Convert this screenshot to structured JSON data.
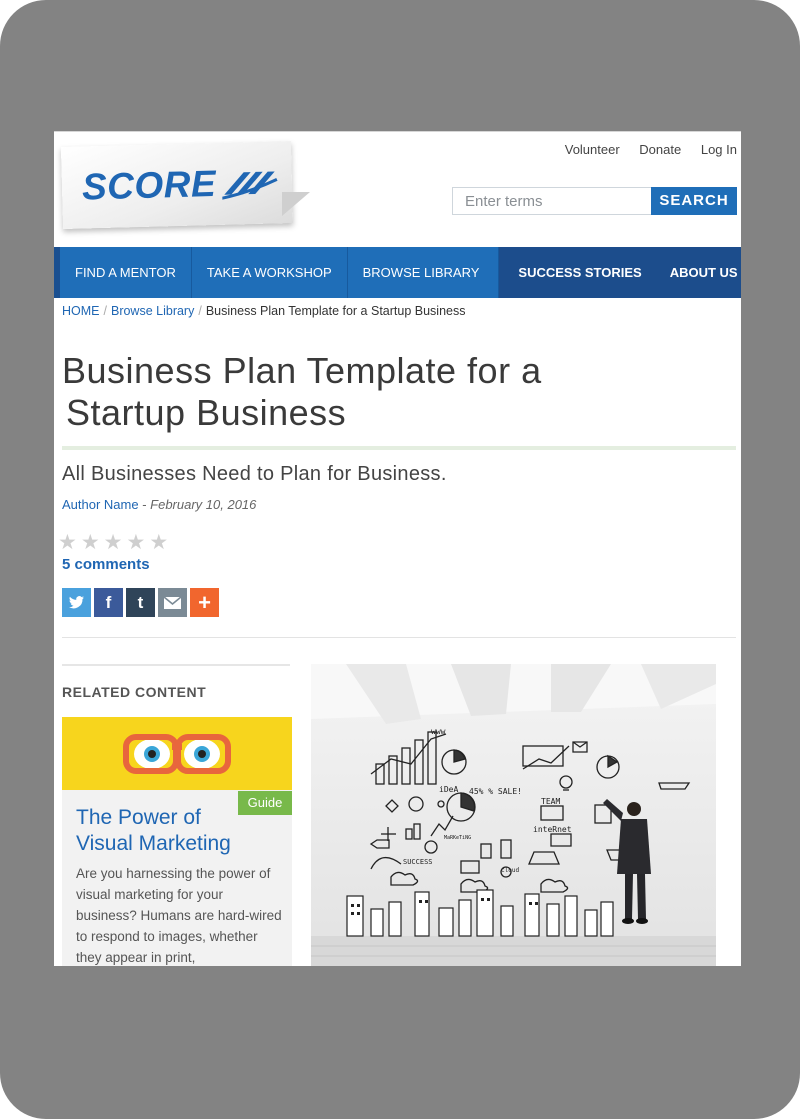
{
  "brand": {
    "logo_text": "SCORE",
    "primary_color": "#1f6eb8",
    "dark_nav_color": "#1c4d8c"
  },
  "top_links": [
    "Volunteer",
    "Donate",
    "Log In"
  ],
  "search": {
    "placeholder": "Enter terms",
    "button_label": "SEARCH"
  },
  "nav": [
    "FIND A MENTOR",
    "TAKE A WORKSHOP",
    "BROWSE LIBRARY",
    "SUCCESS STORIES",
    "ABOUT US"
  ],
  "breadcrumb": {
    "home": "HOME",
    "library": "Browse Library",
    "current": "Business Plan Template for a Startup Business"
  },
  "article": {
    "title_line1": "Business Plan Template for a",
    "title_line2": "Startup Business",
    "subtitle": "All Businesses Need to Plan for Business.",
    "author": "Author Name",
    "date_sep": " - ",
    "date": "February 10, 2016",
    "rating": 0,
    "comments": "5 comments"
  },
  "share_icons": [
    "twitter-icon",
    "facebook-icon",
    "tumblr-icon",
    "email-icon",
    "plus-icon"
  ],
  "related": {
    "heading": "RELATED CONTENT",
    "badge": "Guide",
    "card_title_line1": "The Power of",
    "card_title_line2": "Visual Marketing",
    "card_text": "Are you harnessing the power of visual marketing for your business? Humans are hard-wired to respond to images, whether they appear in print,"
  },
  "hero_texts": {
    "www": "www",
    "idea": "iDeA",
    "sale": "45% % SALE!",
    "team": "TEAM",
    "internet": "inteRnet",
    "marketing": "MaRKeTiNG",
    "cloud": "cloud",
    "success": "SUCCESS"
  }
}
